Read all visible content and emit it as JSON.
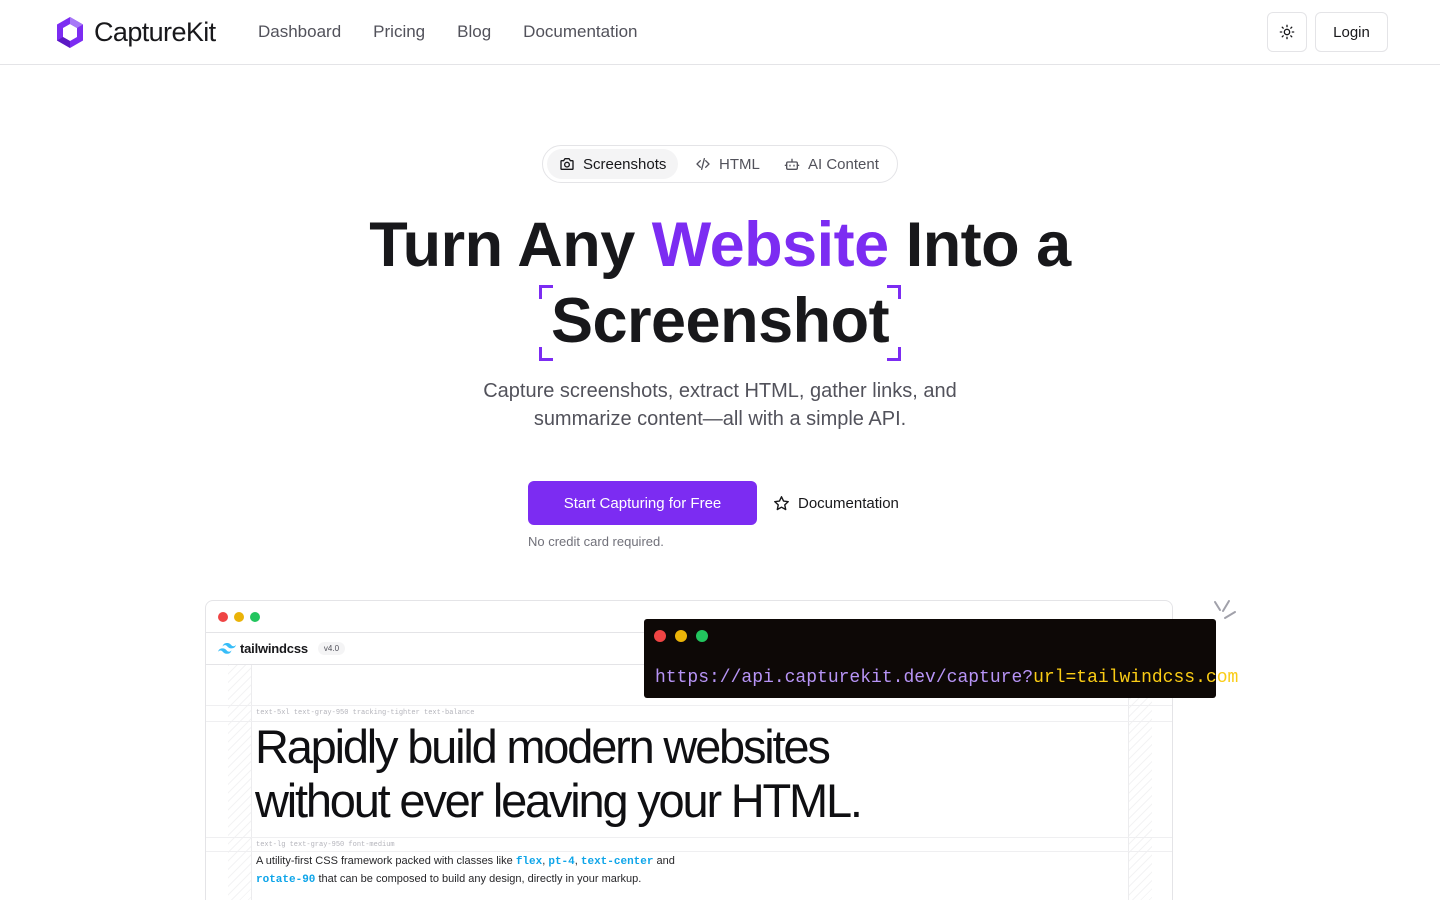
{
  "brand": {
    "name": "CaptureKit",
    "color": "#7c2cf2"
  },
  "nav": {
    "items": [
      {
        "label": "Dashboard"
      },
      {
        "label": "Pricing"
      },
      {
        "label": "Blog"
      },
      {
        "label": "Documentation"
      }
    ],
    "theme_icon": "sun-icon",
    "login_label": "Login"
  },
  "tabs": [
    {
      "label": "Screenshots",
      "icon": "camera-icon",
      "active": true
    },
    {
      "label": "HTML",
      "icon": "code-icon",
      "active": false
    },
    {
      "label": "AI Content",
      "icon": "bot-icon",
      "active": false
    }
  ],
  "hero": {
    "headline_part1": "Turn Any ",
    "headline_accent": "Website",
    "headline_part2": " Into a",
    "headline_line2": "Screenshot",
    "subtitle": "Capture screenshots, extract HTML, gather links, and summarize content—all with a simple API.",
    "cta_label": "Start Capturing for Free",
    "docs_label": "Documentation",
    "docs_icon": "star-icon",
    "note": "No credit card required."
  },
  "preview": {
    "site_name": "tailwindcss",
    "version": "v4.0",
    "class_tag_1": "text-5xl text-gray-950 tracking-tighter text-balance",
    "headline_line1": "Rapidly build modern websites",
    "headline_line2": "without ever leaving your HTML.",
    "class_tag_2": "text-lg text-gray-950 font-medium",
    "body_1": "A utility-first CSS framework packed with classes like ",
    "code_1": "flex",
    "sep_1": ", ",
    "code_2": "pt-4",
    "sep_2": ", ",
    "code_3": "text-center",
    "body_2": " and",
    "code_4": "rotate-90",
    "body_3": " that can be composed to build any design, directly in your markup."
  },
  "terminal": {
    "url_base": "https://api.capturekit.dev/capture?",
    "url_param": "url=tailwindcss.com"
  },
  "colors": {
    "accent": "#7c2cf2",
    "dot_red": "#ef4444",
    "dot_yellow": "#eab308",
    "dot_green": "#22c55e"
  }
}
